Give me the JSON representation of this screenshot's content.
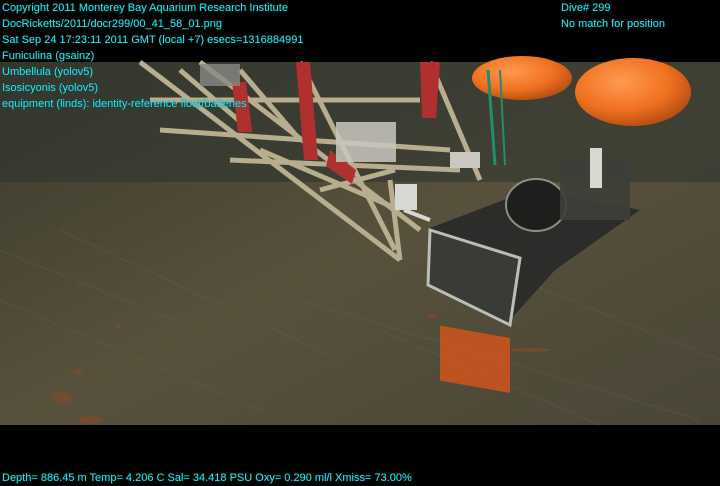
{
  "overlay": {
    "top_left_lines": [
      "Copyright 2011 Monterey Bay Aquarium Research Institute",
      "DocRicketts/2011/docr299/00_41_58_01.png",
      "Sat Sep 24 17:23:11 2011 GMT (local +7)  esecs=1316884991",
      "Funiculina (gsainz)",
      "Umbellula (yolov5)",
      "Isosicyonis (yolov5)",
      "equipment (linds): identity-reference float/batteries"
    ],
    "top_right_lines": [
      "Dive# 299",
      "No match for position"
    ],
    "bottom_line": "Depth= 886.45 m  Temp= 4.206 C  Sal= 34.418 PSU  Oxy= 0.290 ml/l  Xmiss= 73.00%"
  },
  "colors": {
    "overlay_text": "#20e6f0",
    "seafloor": "#4e4a36",
    "float_orange": "#f07020",
    "frame_red": "#b03030",
    "frame_tan": "#b8ad8e"
  }
}
